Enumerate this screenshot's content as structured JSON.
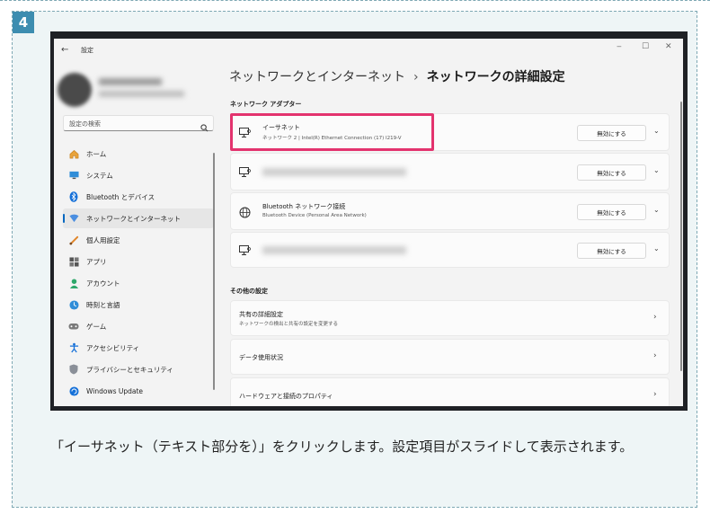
{
  "step": {
    "number": "4"
  },
  "window": {
    "title": "設定",
    "back_glyph": "←",
    "minimize_glyph": "‒",
    "maximize_glyph": "☐",
    "close_glyph": "✕"
  },
  "sidebar": {
    "search_placeholder": "設定の検索",
    "items": [
      {
        "label": "ホーム",
        "icon": "home-icon"
      },
      {
        "label": "システム",
        "icon": "system-icon"
      },
      {
        "label": "Bluetooth とデバイス",
        "icon": "bluetooth-icon"
      },
      {
        "label": "ネットワークとインターネット",
        "icon": "network-icon",
        "selected": true
      },
      {
        "label": "個人用設定",
        "icon": "brush-icon"
      },
      {
        "label": "アプリ",
        "icon": "apps-icon"
      },
      {
        "label": "アカウント",
        "icon": "account-icon"
      },
      {
        "label": "時刻と言語",
        "icon": "time-language-icon"
      },
      {
        "label": "ゲーム",
        "icon": "gaming-icon"
      },
      {
        "label": "アクセシビリティ",
        "icon": "accessibility-icon"
      },
      {
        "label": "プライバシーとセキュリティ",
        "icon": "shield-icon"
      },
      {
        "label": "Windows Update",
        "icon": "update-icon"
      }
    ]
  },
  "breadcrumb": {
    "parent": "ネットワークとインターネット",
    "separator": "›",
    "current": "ネットワークの詳細設定"
  },
  "adapters": {
    "section_title": "ネットワーク アダプター",
    "items": [
      {
        "name": "イーサネット",
        "detail": "ネットワーク 2 | Intel(R) Ethernet Connection (17) I219-V",
        "button": "無効にする",
        "chevron": "⌄"
      },
      {
        "name": "",
        "detail": "",
        "button": "無効にする",
        "chevron": "⌄"
      },
      {
        "name": "Bluetooth ネットワーク接続",
        "detail": "Bluetooth Device (Personal Area Network)",
        "button": "無効にする",
        "chevron": "⌄"
      },
      {
        "name": "",
        "detail": "",
        "button": "無効にする",
        "chevron": "⌄"
      }
    ]
  },
  "other": {
    "section_title": "その他の設定",
    "items": [
      {
        "name": "共有の詳細設定",
        "detail": "ネットワークの検出と共有の設定を変更する",
        "arrow": "›"
      },
      {
        "name": "データ使用状況",
        "arrow": "›"
      },
      {
        "name": "ハードウェアと接続のプロパティ",
        "arrow": "›"
      }
    ]
  },
  "colors": {
    "highlight": "#e3336e",
    "accent": "#0067c0",
    "step_badge": "#3d8db0"
  },
  "caption": "「イーサネット（テキスト部分を）」をクリックします。設定項目がスライドして表示されます。"
}
